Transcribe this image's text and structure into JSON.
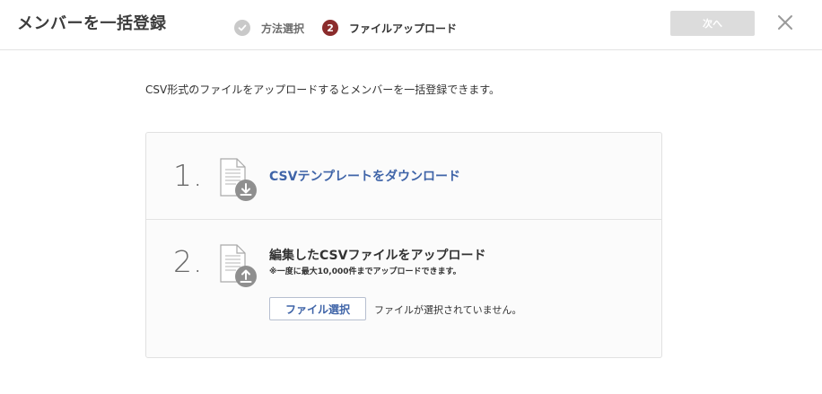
{
  "header": {
    "title": "メンバーを一括登録",
    "steps": [
      {
        "label": "方法選択",
        "status": "done",
        "icon": "check-icon"
      },
      {
        "label": "ファイルアップロード",
        "status": "active",
        "number": "2"
      }
    ],
    "next_label": "次へ",
    "close_icon": "close-icon"
  },
  "main": {
    "intro": "CSV形式のファイルをアップロードするとメンバーを一括登録できます。",
    "step1": {
      "number": "1.",
      "icon": "document-download-icon",
      "link_label": "CSVテンプレートをダウンロード"
    },
    "step2": {
      "number": "2.",
      "icon": "document-upload-icon",
      "title": "編集したCSVファイルをアップロード",
      "note": "※一度に最大10,000件までアップロードできます。",
      "button_label": "ファイル選択",
      "file_status": "ファイルが選択されていません。"
    }
  },
  "colors": {
    "accent_link": "#3f64a8",
    "step_active_badge": "#8b2c2c",
    "step_done_badge": "#c9c9c9",
    "next_button_disabled": "#dcdcdc"
  }
}
